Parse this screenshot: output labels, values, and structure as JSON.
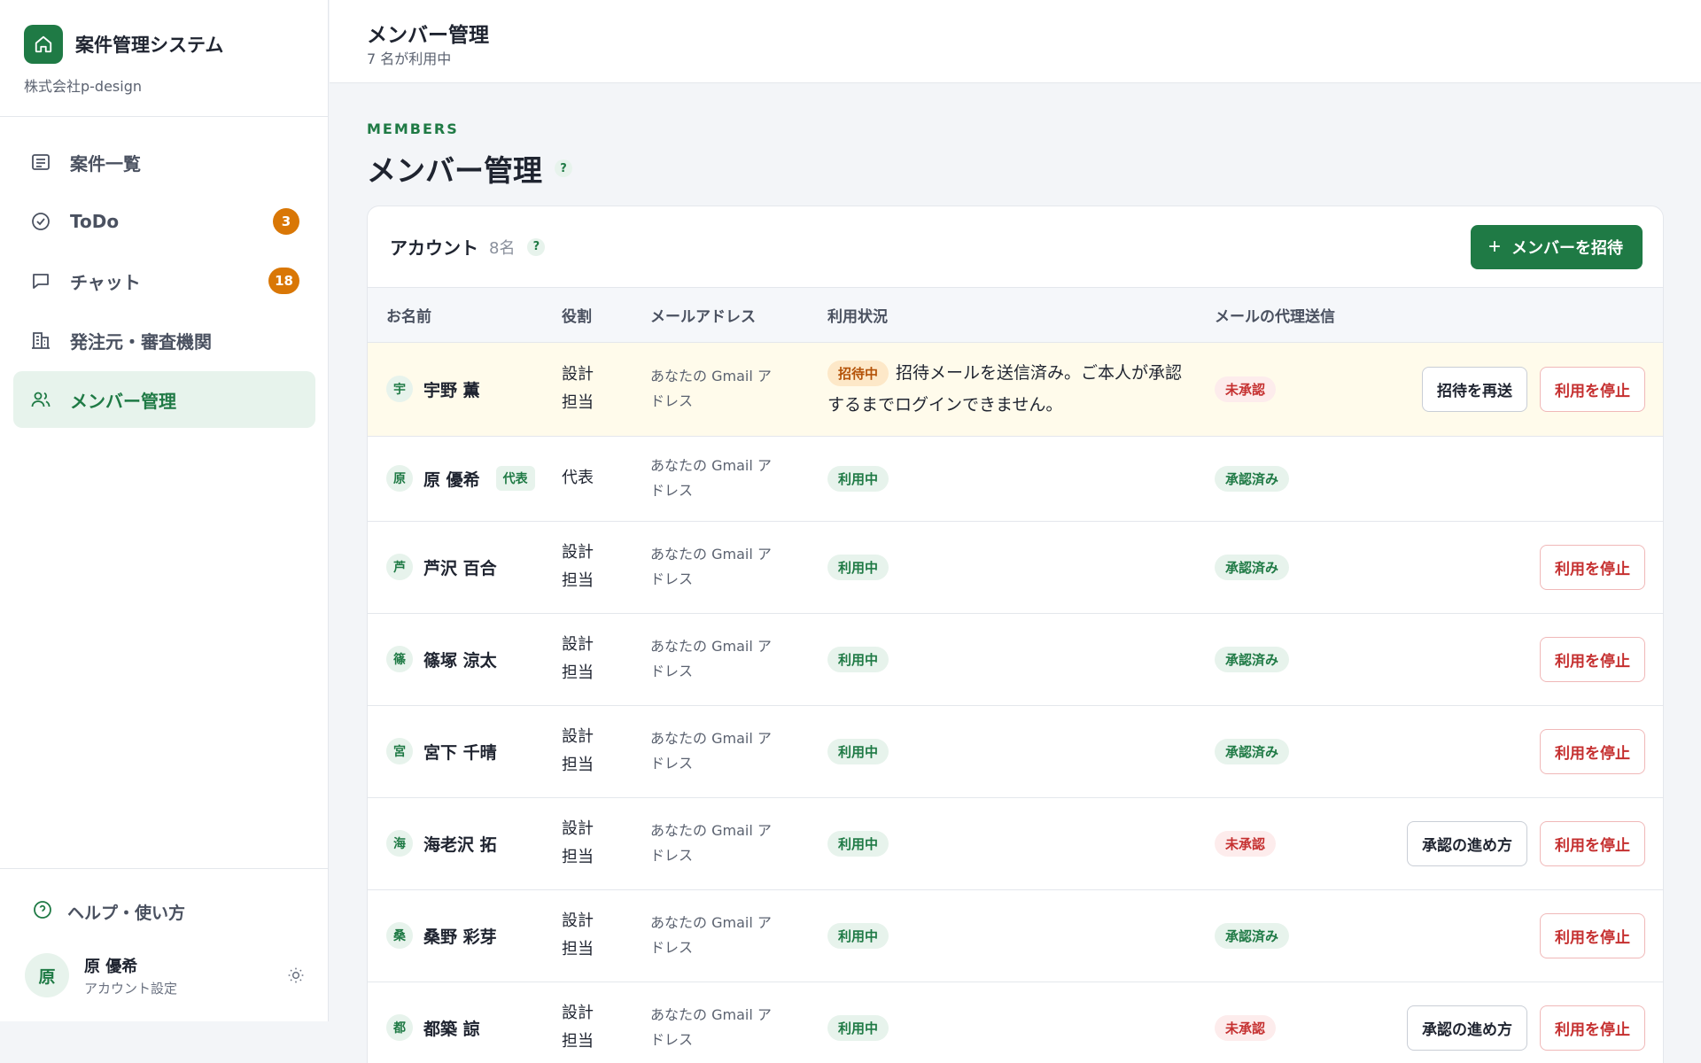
{
  "sidebar": {
    "app_name": "案件管理システム",
    "company": "株式会社p-design",
    "nav": [
      {
        "label": "案件一覧",
        "icon": "list-icon",
        "badge": null,
        "active": false
      },
      {
        "label": "ToDo",
        "icon": "check-circle-icon",
        "badge": "3",
        "active": false
      },
      {
        "label": "チャット",
        "icon": "chat-icon",
        "badge": "18",
        "active": false
      },
      {
        "label": "発注元・審査機関",
        "icon": "building-icon",
        "badge": null,
        "active": false
      },
      {
        "label": "メンバー管理",
        "icon": "users-icon",
        "badge": null,
        "active": true
      }
    ],
    "help_label": "ヘルプ・使い方",
    "user": {
      "avatar": "原",
      "name": "原 優希",
      "sub": "アカウント設定"
    }
  },
  "header": {
    "title": "メンバー管理",
    "subtitle": "7 名が利用中"
  },
  "main": {
    "eyebrow": "MEMBERS",
    "title": "メンバー管理",
    "help_mark": "?",
    "card": {
      "title": "アカウント",
      "count": "8名",
      "invite_label": "メンバーを招待",
      "columns": [
        "お名前",
        "役割",
        "メールアドレス",
        "利用状況",
        "メールの代理送信"
      ],
      "rows": [
        {
          "avatar": "宇",
          "name": "宇野 薫",
          "rep": "",
          "role": "設計担当",
          "email": "あなたの Gmail アドレス",
          "status": "招待中",
          "status_note": "招待メールを送信済み。ご本人が承認するまでログインできません。",
          "proxy": "未承認",
          "action": "招待を再送",
          "stop": "利用を停止",
          "pending": true
        },
        {
          "avatar": "原",
          "name": "原 優希",
          "rep": "代表",
          "role": "代表",
          "email": "あなたの Gmail アドレス",
          "status": "利用中",
          "status_note": "",
          "proxy": "承認済み",
          "action": "",
          "stop": "",
          "pending": false
        },
        {
          "avatar": "芦",
          "name": "芦沢 百合",
          "rep": "",
          "role": "設計担当",
          "email": "あなたの Gmail アドレス",
          "status": "利用中",
          "status_note": "",
          "proxy": "承認済み",
          "action": "",
          "stop": "利用を停止",
          "pending": false
        },
        {
          "avatar": "篠",
          "name": "篠塚 涼太",
          "rep": "",
          "role": "設計担当",
          "email": "あなたの Gmail アドレス",
          "status": "利用中",
          "status_note": "",
          "proxy": "承認済み",
          "action": "",
          "stop": "利用を停止",
          "pending": false
        },
        {
          "avatar": "宮",
          "name": "宮下 千晴",
          "rep": "",
          "role": "設計担当",
          "email": "あなたの Gmail アドレス",
          "status": "利用中",
          "status_note": "",
          "proxy": "承認済み",
          "action": "",
          "stop": "利用を停止",
          "pending": false
        },
        {
          "avatar": "海",
          "name": "海老沢 拓",
          "rep": "",
          "role": "設計担当",
          "email": "あなたの Gmail アドレス",
          "status": "利用中",
          "status_note": "",
          "proxy": "未承認",
          "action": "承認の進め方",
          "stop": "利用を停止",
          "pending": false
        },
        {
          "avatar": "桑",
          "name": "桑野 彩芽",
          "rep": "",
          "role": "設計担当",
          "email": "あなたの Gmail アドレス",
          "status": "利用中",
          "status_note": "",
          "proxy": "承認済み",
          "action": "",
          "stop": "利用を停止",
          "pending": false
        },
        {
          "avatar": "都",
          "name": "都築 諒",
          "rep": "",
          "role": "設計担当",
          "email": "あなたの Gmail アドレス",
          "status": "利用中",
          "status_note": "",
          "proxy": "未承認",
          "action": "承認の進め方",
          "stop": "利用を停止",
          "pending": false
        }
      ]
    }
  },
  "colors": {
    "brand": "#1f7a45",
    "badge": "#d97706",
    "danger": "#c53030",
    "pending_row": "#fffbeb"
  }
}
